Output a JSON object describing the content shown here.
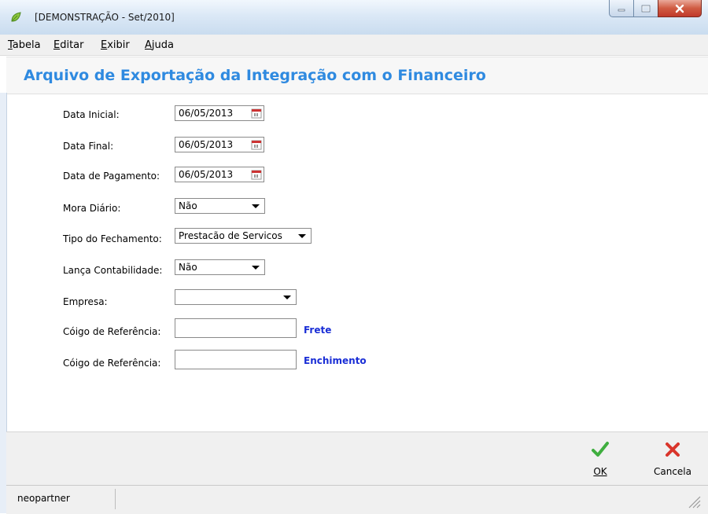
{
  "window": {
    "title": "[DEMONSTRAÇÃO - Set/2010]"
  },
  "menu": {
    "items": [
      {
        "accel": "T",
        "rest": "abela"
      },
      {
        "accel": "E",
        "rest": "ditar"
      },
      {
        "accel": "E",
        "rest": "xibir"
      },
      {
        "accel": "A",
        "rest": "juda"
      }
    ]
  },
  "heading": "Arquivo de Exportação da Integração com o Financeiro",
  "form": {
    "data_inicial": {
      "label": "Data Inicial:",
      "value": "06/05/2013"
    },
    "data_final": {
      "label": "Data Final:",
      "value": "06/05/2013"
    },
    "data_pagamento": {
      "label": "Data de Pagamento:",
      "value": "06/05/2013"
    },
    "mora_diario": {
      "label": "Mora Diário:",
      "value": "Não"
    },
    "tipo_fechamento": {
      "label": "Tipo do Fechamento:",
      "value": "Prestacão de Servicos"
    },
    "lanca_contabilidade": {
      "label": "Lança Contabilidade:",
      "value": "Não"
    },
    "empresa": {
      "label": "Empresa:",
      "value": ""
    },
    "ref_frete": {
      "label": "Cóigo de Referência:",
      "value": "",
      "tag": "Frete"
    },
    "ref_enchimento": {
      "label": "Cóigo de Referência:",
      "value": "",
      "tag": "Enchimento"
    }
  },
  "actions": {
    "ok_label": "OK",
    "cancel_label": "Cancela"
  },
  "status": {
    "user": "neopartner"
  },
  "colors": {
    "heading": "#2f8ae0",
    "tag": "#1a2ed6",
    "ok_icon": "#3fae3f",
    "cancel_icon": "#d9352b"
  }
}
